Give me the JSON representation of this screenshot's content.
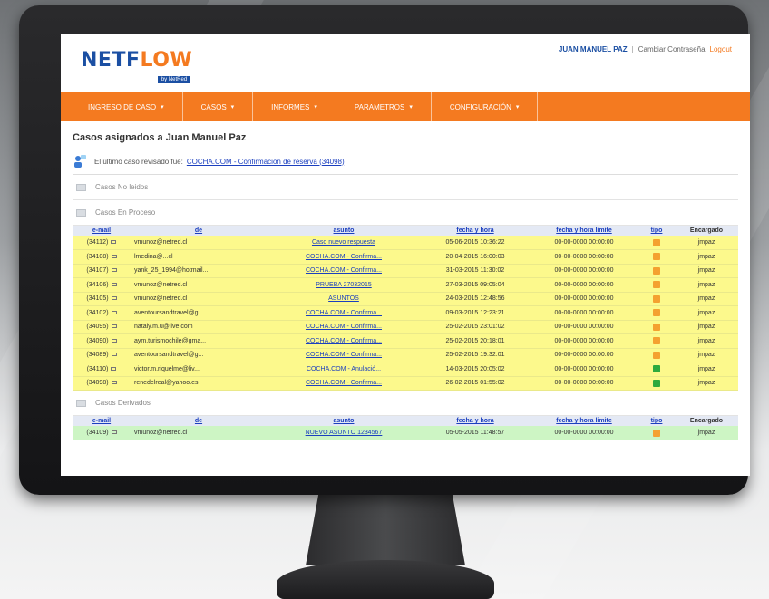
{
  "header": {
    "logo_main": "NETF",
    "logo_accent": "LOW",
    "logo_tag": "by NetRed",
    "user_name": "JUAN MANUEL PAZ",
    "separator": "|",
    "change_password": "Cambiar Contraseña",
    "logout": "Logout"
  },
  "nav": [
    {
      "label": "INGRESO DE CASO"
    },
    {
      "label": "CASOS"
    },
    {
      "label": "INFORMES"
    },
    {
      "label": "PARAMETROS"
    },
    {
      "label": "CONFIGURACIÓN"
    }
  ],
  "nav_caret": "▾",
  "page": {
    "title": "Casos asignados a Juan Manuel Paz",
    "last_case_prefix": "El último caso revisado fue:",
    "last_case_link": "COCHA.COM - Confirmación de reserva (34098)"
  },
  "sections": {
    "unread": "Casos No leidos",
    "in_process": "Casos En Proceso",
    "derived": "Casos Derivados"
  },
  "columns": {
    "email": "e-mail",
    "from": "de",
    "subject": "asunto",
    "datetime": "fecha y hora",
    "deadline": "fecha y hora limite",
    "type": "tipo",
    "owner": "Encargado"
  },
  "in_process_rows": [
    {
      "id": "(34112)",
      "from": "vmunoz@netred.cl",
      "subject": "Caso nuevo respuesta",
      "date": "05-06-2015 10:36:22",
      "deadline": "00-00-0000 00:00:00",
      "type": "orange",
      "owner": "jmpaz"
    },
    {
      "id": "(34108)",
      "from": "lmedina@...cl",
      "subject": "COCHA.COM - Confirma...",
      "date": "20-04-2015 16:00:03",
      "deadline": "00-00-0000 00:00:00",
      "type": "orange",
      "owner": "jmpaz"
    },
    {
      "id": "(34107)",
      "from": "yank_25_1994@hotmail...",
      "subject": "COCHA.COM - Confirma...",
      "date": "31-03-2015 11:30:02",
      "deadline": "00-00-0000 00:00:00",
      "type": "orange",
      "owner": "jmpaz"
    },
    {
      "id": "(34106)",
      "from": "vmunoz@netred.cl",
      "subject": "PRUEBA 27032015",
      "date": "27-03-2015 09:05:04",
      "deadline": "00-00-0000 00:00:00",
      "type": "orange",
      "owner": "jmpaz"
    },
    {
      "id": "(34105)",
      "from": "vmunoz@netred.cl",
      "subject": "ASUNTOS",
      "date": "24-03-2015 12:48:56",
      "deadline": "00-00-0000 00:00:00",
      "type": "orange",
      "owner": "jmpaz"
    },
    {
      "id": "(34102)",
      "from": "aventoursandtravel@g...",
      "subject": "COCHA.COM - Confirma...",
      "date": "09-03-2015 12:23:21",
      "deadline": "00-00-0000 00:00:00",
      "type": "orange",
      "owner": "jmpaz"
    },
    {
      "id": "(34095)",
      "from": "nataly.m.u@live.com",
      "subject": "COCHA.COM - Confirma...",
      "date": "25-02-2015 23:01:02",
      "deadline": "00-00-0000 00:00:00",
      "type": "orange",
      "owner": "jmpaz"
    },
    {
      "id": "(34090)",
      "from": "aym.turismochile@gma...",
      "subject": "COCHA.COM - Confirma...",
      "date": "25-02-2015 20:18:01",
      "deadline": "00-00-0000 00:00:00",
      "type": "orange",
      "owner": "jmpaz"
    },
    {
      "id": "(34089)",
      "from": "aventoursandtravel@g...",
      "subject": "COCHA.COM - Confirma...",
      "date": "25-02-2015 19:32:01",
      "deadline": "00-00-0000 00:00:00",
      "type": "orange",
      "owner": "jmpaz"
    },
    {
      "id": "(34110)",
      "from": "victor.m.riquelme@liv...",
      "subject": "COCHA.COM - Anulació...",
      "date": "14-03-2015 20:05:02",
      "deadline": "00-00-0000 00:00:00",
      "type": "green",
      "owner": "jmpaz"
    },
    {
      "id": "(34098)",
      "from": "renedelreal@yahoo.es",
      "subject": "COCHA.COM - Confirma...",
      "date": "26-02-2015 01:55:02",
      "deadline": "00-00-0000 00:00:00",
      "type": "green",
      "owner": "jmpaz"
    }
  ],
  "derived_rows": [
    {
      "id": "(34109)",
      "from": "vmunoz@netred.cl",
      "subject": "NUEVO ASUNTO 1234567",
      "date": "05-05-2015 11:48:57",
      "deadline": "00-00-0000 00:00:00",
      "type": "orange",
      "owner": "jmpaz"
    }
  ]
}
